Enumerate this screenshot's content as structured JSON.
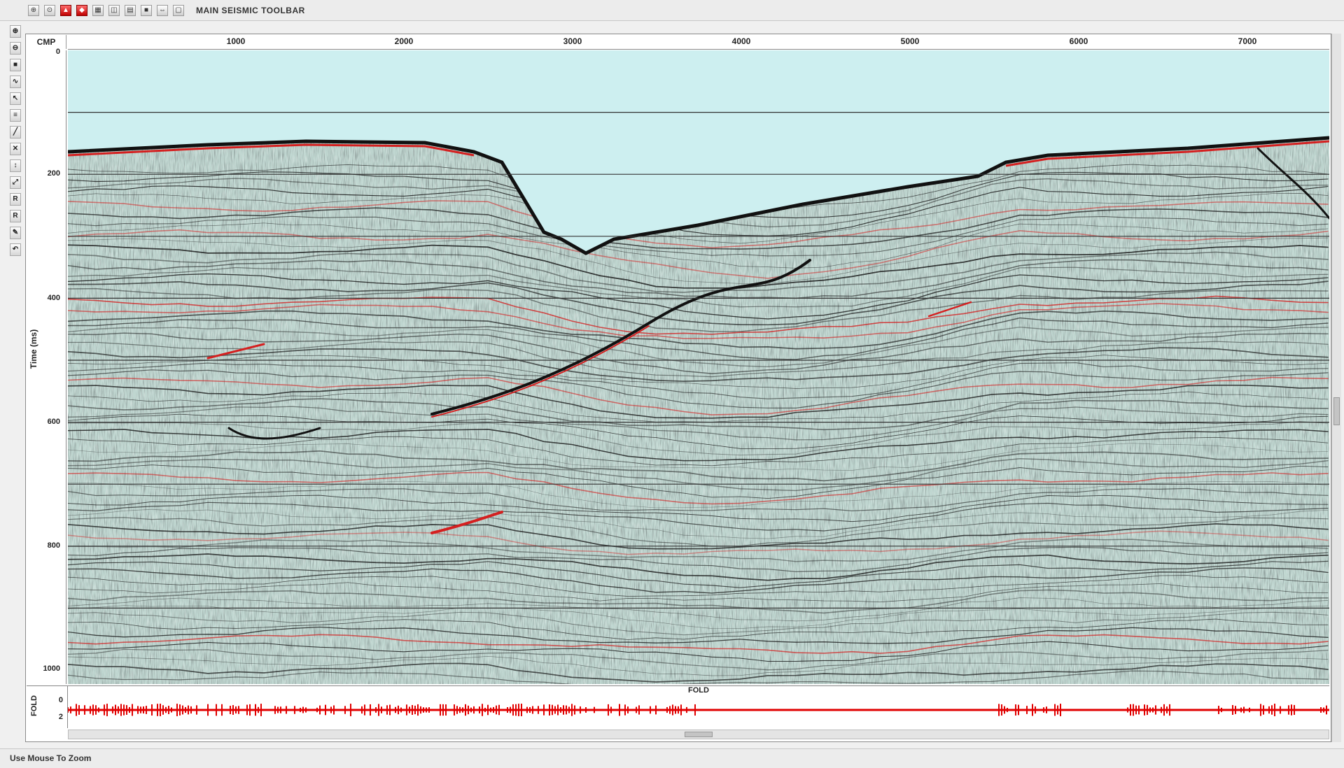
{
  "toolbar": {
    "title": "MAIN SEISMIC TOOLBAR",
    "buttons": [
      "select-tool",
      "pick-tool",
      "color-tool",
      "horizon-tool",
      "grid-tool",
      "view-tool",
      "display-tool",
      "scale-tool",
      "zoom-tool",
      "export-tool"
    ]
  },
  "left_tools": [
    "zoom-in",
    "zoom-out",
    "fit",
    "wiggle",
    "select",
    "horizon",
    "fault",
    "pick",
    "move",
    "measure",
    "reset",
    "redraw",
    "report",
    "undo"
  ],
  "section": {
    "x_axis_label": "CMP",
    "x_ticks": [
      "1000",
      "2000",
      "3000",
      "4000",
      "5000",
      "6000",
      "7000"
    ],
    "y_axis_label": "Time (ms)",
    "y_ticks": [
      "0",
      "200",
      "400",
      "600",
      "800",
      "1000"
    ]
  },
  "fold_panel": {
    "title": "FOLD",
    "side_label": "FOLD",
    "ticks": [
      "0",
      "2"
    ]
  },
  "status": {
    "text": "Use Mouse To Zoom"
  },
  "colors": {
    "water": "#cdeff0",
    "background": "#c8ddd8",
    "reflector_dark": "#1a1a1a",
    "reflector_red": "#d42020",
    "fold_trace": "#e00000"
  }
}
